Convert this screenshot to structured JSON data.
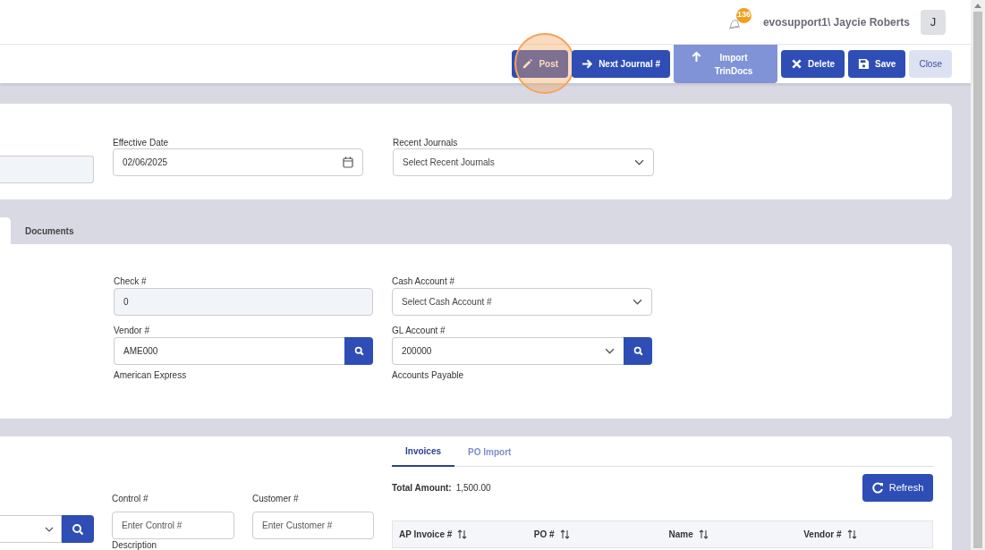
{
  "header": {
    "notification_count": "136",
    "user": "evosupport1\\ Jaycie Roberts",
    "avatar": "J"
  },
  "toolbar": {
    "buttons": [
      {
        "label": "Post",
        "kind": "primary",
        "disabled": false,
        "highlighted": true
      },
      {
        "label": "Next Journal #",
        "kind": "primary",
        "disabled": false,
        "highlighted": false
      },
      {
        "label": "Import TrinDocs",
        "kind": "primary",
        "disabled": true,
        "highlighted": false
      },
      {
        "label": "Delete",
        "kind": "primary",
        "disabled": false,
        "highlighted": false
      },
      {
        "label": "Save",
        "kind": "primary",
        "disabled": false,
        "highlighted": false
      },
      {
        "label": "Close",
        "kind": "light",
        "disabled": false,
        "highlighted": false
      }
    ]
  },
  "journal": {
    "fields": [
      {
        "kind": "readonly"
      },
      {
        "kind": "date",
        "label": "Effective Date",
        "value": "02/06/2025"
      },
      {
        "kind": "select",
        "label": "Recent Journals",
        "placeholder": "Select Recent Journals"
      }
    ]
  },
  "tabs": [
    {
      "selected": true
    },
    {
      "label": "Documents",
      "selected": false
    }
  ],
  "details": {
    "left": [
      {
        "kind": "readonly",
        "label": "Check #",
        "value": "0"
      },
      {
        "kind": "lookup",
        "label": "Vendor #",
        "value": "AME000",
        "caption": "American Express"
      }
    ],
    "right": [
      {
        "kind": "select",
        "label": "Cash Account #",
        "placeholder": "Select Cash Account #"
      },
      {
        "kind": "select-lookup",
        "label": "GL Account #",
        "value": "200000",
        "caption": "Accounts Payable"
      }
    ]
  },
  "lines": {
    "control": {
      "label": "Control #",
      "placeholder": "Enter Control #"
    },
    "customer": {
      "label": "Customer #",
      "placeholder": "Enter Customer #"
    },
    "description_label": "Description",
    "tabs": [
      {
        "label": "Invoices",
        "selected": true
      },
      {
        "label": "PO Import",
        "selected": false
      }
    ],
    "total_label": "Total Amount:",
    "total_value": "1,500.00",
    "refresh": "Refresh",
    "columns": [
      "AP Invoice #",
      "PO #",
      "Name",
      "Vendor #"
    ]
  }
}
